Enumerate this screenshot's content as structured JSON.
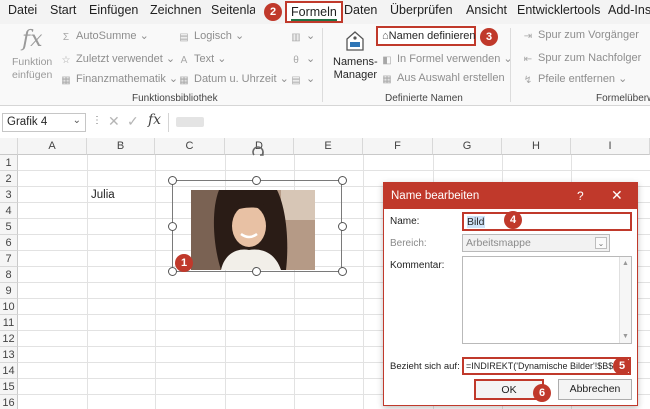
{
  "menu": {
    "tabs": [
      "Datei",
      "Start",
      "Einfügen",
      "Zeichnen",
      "Seitenlayo",
      "Formeln",
      "Daten",
      "Überprüfen",
      "Ansicht",
      "Entwicklertools",
      "Add-Ins"
    ],
    "active": "Formeln"
  },
  "ribbon": {
    "insert_function": "Funktion\neinfügen",
    "autosum": "AutoSumme",
    "recent": "Zuletzt verwendet",
    "financial": "Finanzmathematik",
    "logical": "Logisch",
    "text": "Text",
    "datetime": "Datum u. Uhrzeit",
    "group_function_library": "Funktionsbibliothek",
    "name_manager": "Namens-\nManager",
    "define_name": "Namen definieren",
    "use_in_formula": "In Formel verwenden",
    "create_from_selection": "Aus Auswahl erstellen",
    "group_defined_names": "Definierte Namen",
    "trace_precedents": "Spur zum Vorgänger",
    "trace_dependents": "Spur zum Nachfolger",
    "remove_arrows": "Pfeile entfernen",
    "group_formula_auditing": "Formelüberwa"
  },
  "formula_bar": {
    "name_box": "Grafik 4",
    "cancel_symbol": "✕",
    "enter_symbol": "✓",
    "fx_symbol": "fx"
  },
  "sheet": {
    "columns": [
      "A",
      "B",
      "C",
      "D",
      "E",
      "F",
      "G",
      "H",
      "I"
    ],
    "rows": [
      "1",
      "2",
      "3",
      "4",
      "5",
      "6",
      "7",
      "8",
      "9",
      "10",
      "11",
      "12",
      "13",
      "14",
      "15",
      "16"
    ],
    "cell_b3": "Julia"
  },
  "dialog": {
    "title": "Name bearbeiten",
    "help": "?",
    "close": "✕",
    "name_label": "Name:",
    "name_value": "Bild",
    "scope_label": "Bereich:",
    "scope_value": "Arbeitsmappe",
    "comment_label": "Kommentar:",
    "comment_value": "",
    "refers_to_label": "Bezieht sich auf:",
    "refers_to_value": "=INDIREKT('Dynamische Bilder'!$B$3)",
    "ok": "OK",
    "cancel": "Abbrechen"
  },
  "badges": [
    "1",
    "2",
    "3",
    "4",
    "5",
    "6"
  ],
  "colors": {
    "accent": "#c0392b",
    "excel_green": "#217346"
  }
}
